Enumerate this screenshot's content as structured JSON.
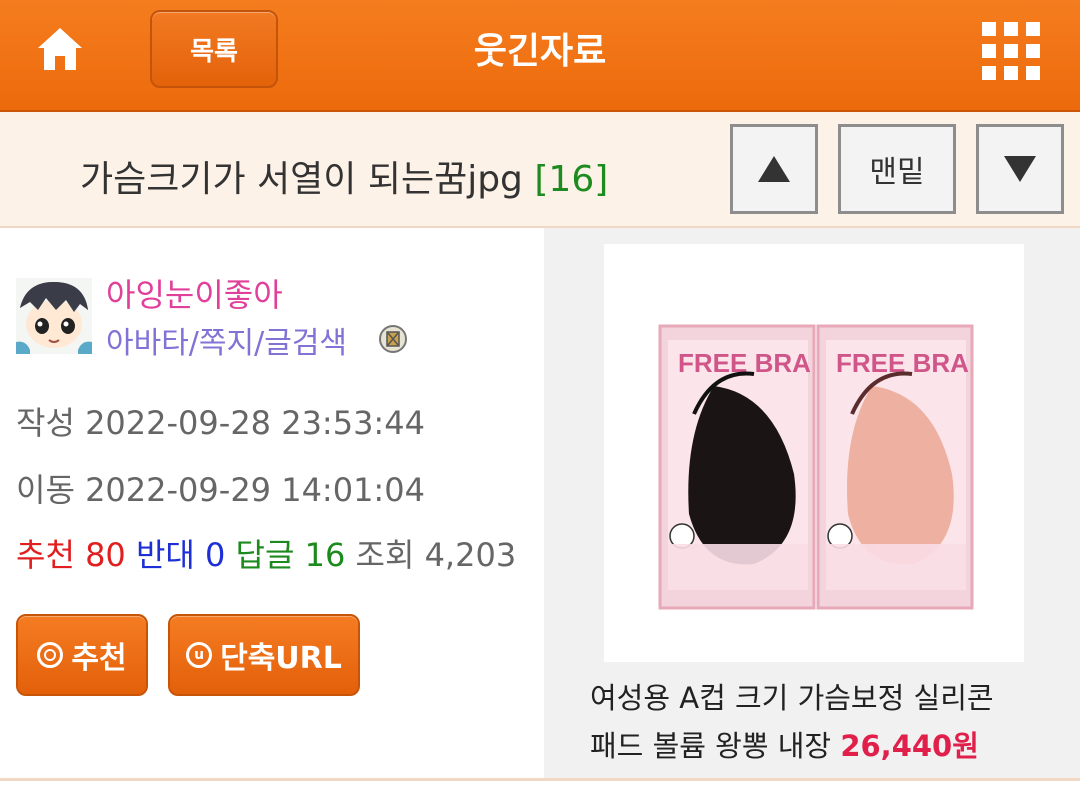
{
  "header": {
    "home_icon": "home-icon",
    "list_label": "목록",
    "board_title": "웃긴자료",
    "menu_icon": "grid-menu-icon"
  },
  "post": {
    "title": "가슴크기가 서열이 되는꿈jpg",
    "comment_count": "[16]",
    "nav_up": "▲",
    "nav_bottom": "맨밑",
    "nav_down": "▼"
  },
  "author": {
    "nickname": "아잉눈이좋아",
    "links": "아바타/쪽지/글검색"
  },
  "meta": {
    "written_label": "작성",
    "written_value": "2022-09-28 23:53:44",
    "moved_label": "이동",
    "moved_value": "2022-09-29 14:01:04"
  },
  "stats": {
    "recommend_label": "추천",
    "recommend_value": "80",
    "oppose_label": "반대",
    "oppose_value": "0",
    "reply_label": "답글",
    "reply_value": "16",
    "views_label": "조회",
    "views_value": "4,203"
  },
  "actions": {
    "recommend_label": "추천",
    "shorturl_label": "단축URL"
  },
  "ad": {
    "product_brand": "FREE BRA",
    "product_text_line1": "여성용 A컵 크기 가슴보정 실리콘",
    "product_text_line2": "패드 볼륨 왕뽕 내장",
    "price": "26,440원"
  },
  "colors": {
    "accent": "#ef7010",
    "recommend": "#e02020",
    "oppose": "#1d2fd6",
    "reply": "#1d8a1d",
    "nickname": "#e0409a",
    "price": "#e0204a"
  }
}
